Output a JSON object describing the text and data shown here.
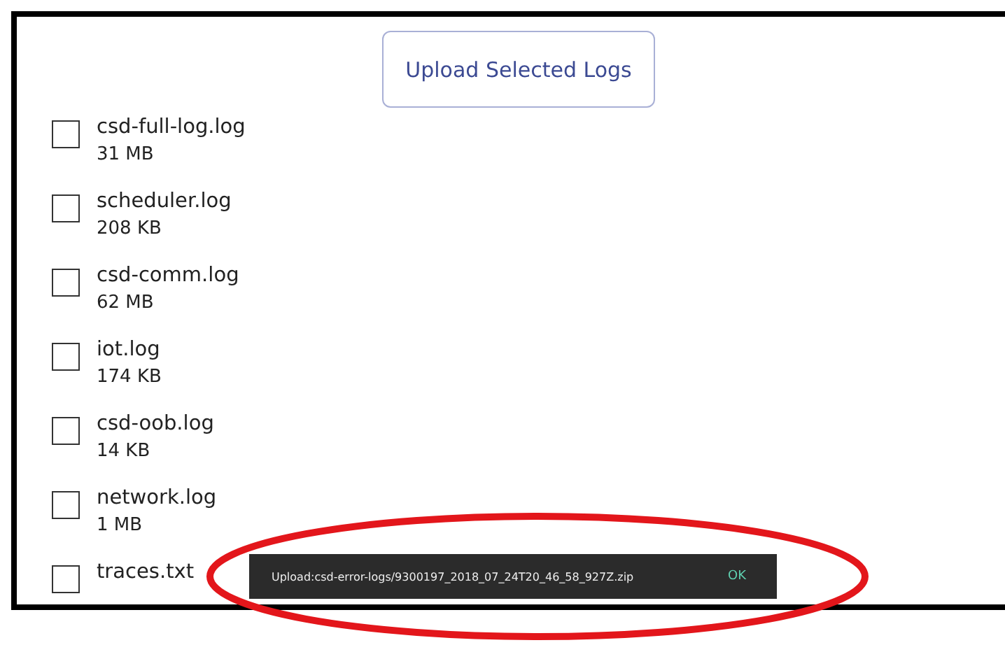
{
  "upload_button": {
    "label": "Upload Selected Logs"
  },
  "files": [
    {
      "name": "csd-full-log.log",
      "size": "31 MB",
      "checked": false
    },
    {
      "name": "scheduler.log",
      "size": "208 KB",
      "checked": false
    },
    {
      "name": "csd-comm.log",
      "size": "62 MB",
      "checked": false
    },
    {
      "name": "iot.log",
      "size": "174 KB",
      "checked": false
    },
    {
      "name": "csd-oob.log",
      "size": "14 KB",
      "checked": false
    },
    {
      "name": "network.log",
      "size": "1 MB",
      "checked": false
    },
    {
      "name": "traces.txt",
      "checked": false
    }
  ],
  "snackbar": {
    "message": "Upload:csd-error-logs/9300197_2018_07_24T20_46_58_927Z.zip",
    "action": "OK"
  }
}
